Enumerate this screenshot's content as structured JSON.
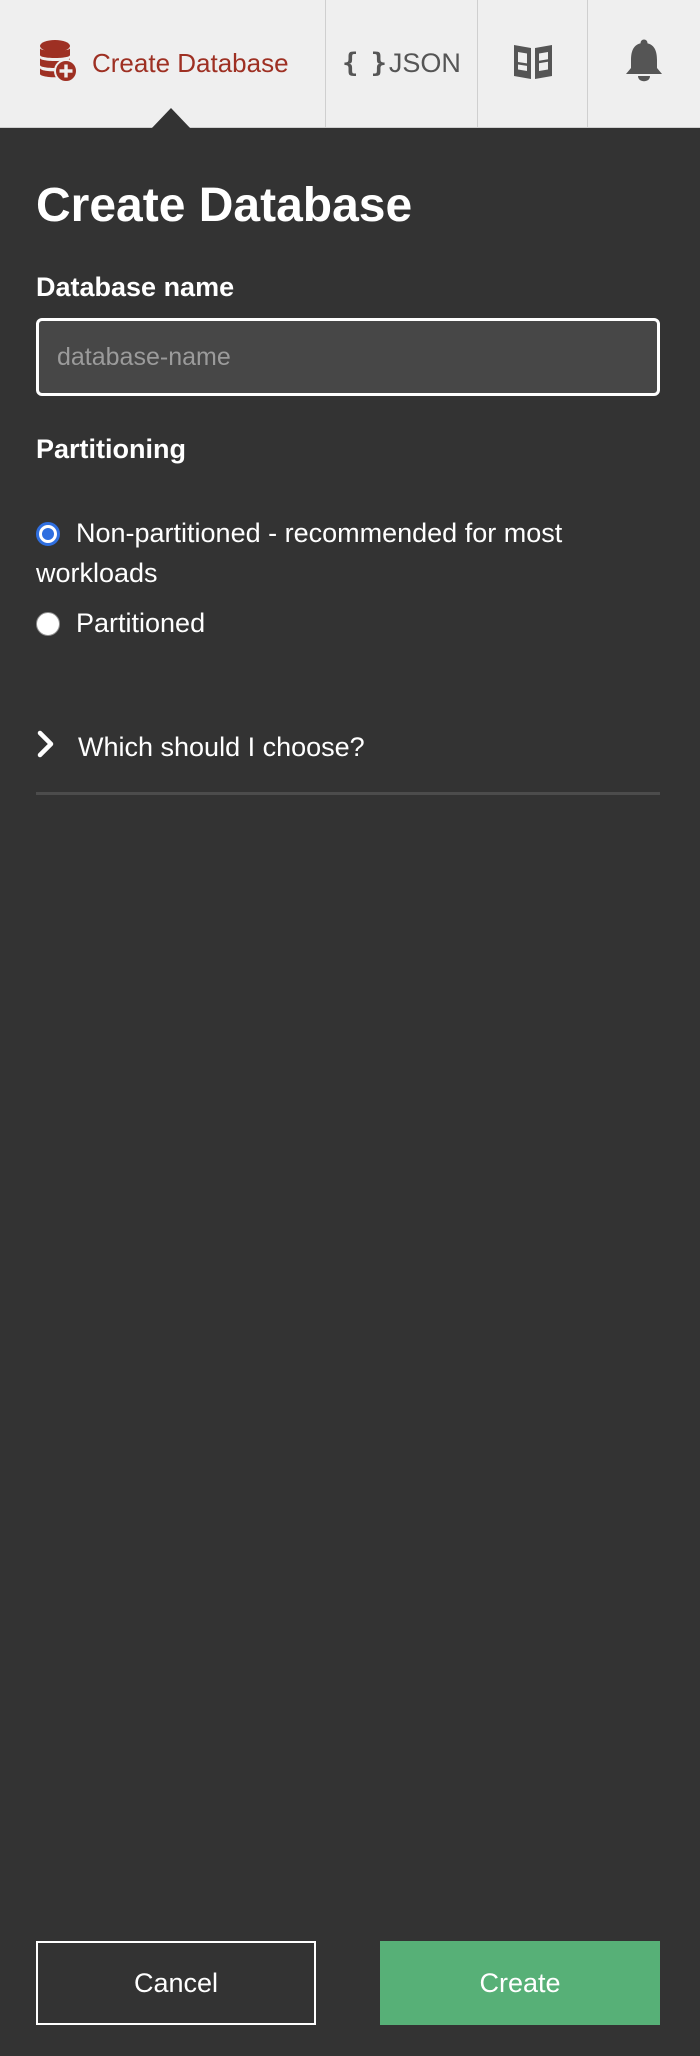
{
  "toolbar": {
    "create_database_label": "Create Database",
    "json_braces": "{ }",
    "json_label": "JSON",
    "create_icon": "database-plus-icon",
    "docs_icon": "open-book-icon",
    "notifications_icon": "bell-icon",
    "accent_color": "#9e3023"
  },
  "panel": {
    "title": "Create Database",
    "name_label": "Database name",
    "name_placeholder": "database-name",
    "name_value": "",
    "partitioning_label": "Partitioning",
    "options": [
      {
        "label": "Non-partitioned - recommended for most workloads",
        "selected": true
      },
      {
        "label": "Partitioned",
        "selected": false
      }
    ],
    "help_label": "Which should I choose?",
    "help_expanded": false
  },
  "footer": {
    "cancel_label": "Cancel",
    "create_label": "Create",
    "create_color": "#57b077"
  }
}
